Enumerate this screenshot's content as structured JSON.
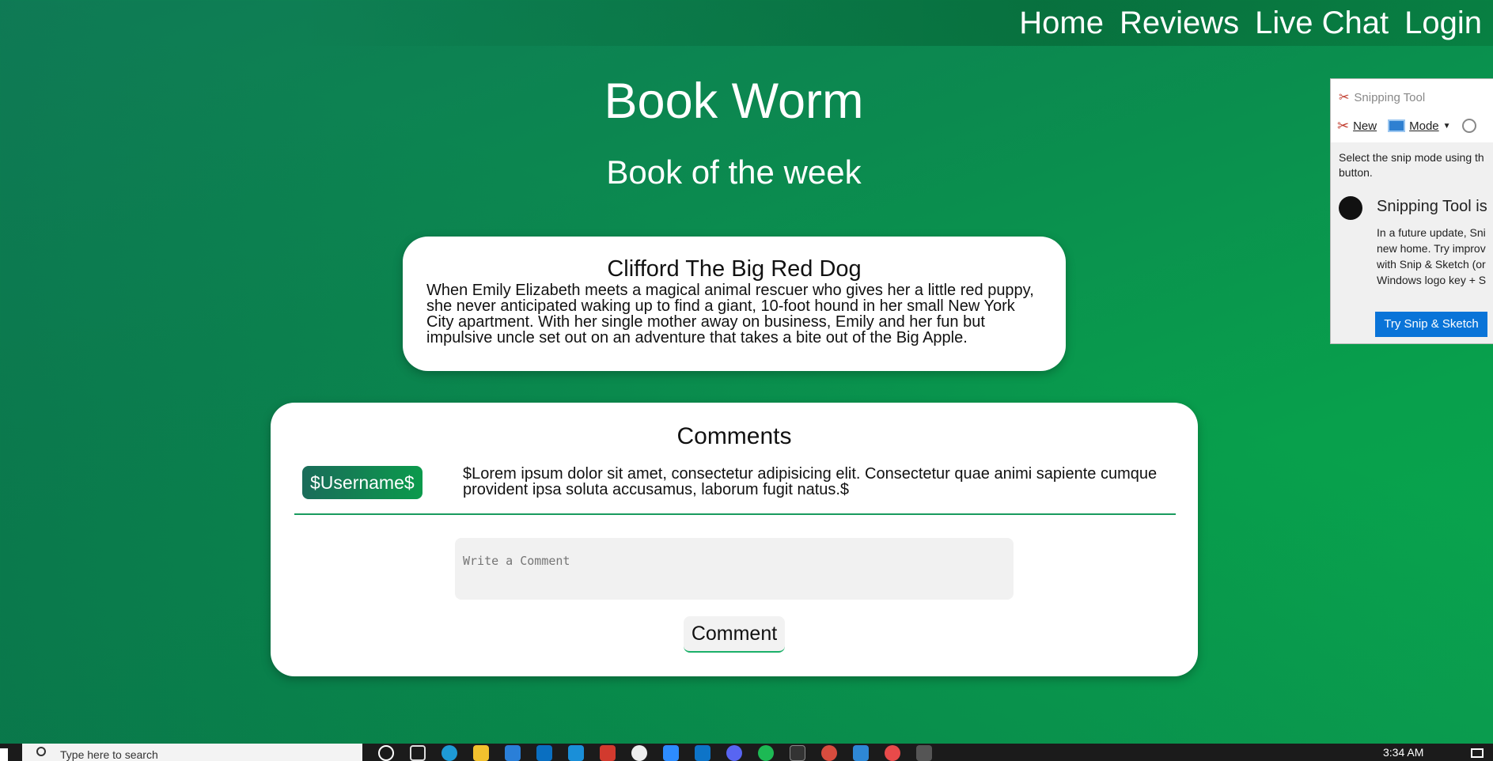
{
  "nav": {
    "items": [
      {
        "label": "Home"
      },
      {
        "label": "Reviews"
      },
      {
        "label": "Live Chat"
      },
      {
        "label": "Login"
      }
    ]
  },
  "site": {
    "title": "Book Worm",
    "subtitle": "Book of the week"
  },
  "book": {
    "title": "Clifford The Big Red Dog",
    "description": "When Emily Elizabeth meets a magical animal rescuer who gives her a little red puppy, she never anticipated waking up to find a giant, 10-foot hound in her small New York City apartment. With her single mother away on business, Emily and her fun but impulsive uncle set out on an adventure that takes a bite out of the Big Apple."
  },
  "comments": {
    "heading": "Comments",
    "items": [
      {
        "username": "$Username$",
        "text": "$Lorem ipsum dolor sit amet, consectetur adipisicing elit. Consectetur quae animi sapiente cumque provident ipsa soluta accusamus, laborum fugit natus.$"
      }
    ],
    "input_placeholder": "Write a Comment",
    "submit_label": "Comment"
  },
  "snipping_tool": {
    "window_title": "Snipping Tool",
    "new_label": "New",
    "mode_label": "Mode",
    "hint": "Select the snip mode using th",
    "hint_line2": "button.",
    "notice_title": "Snipping Tool is",
    "notice_lines": [
      "In a future update, Sni",
      "new home. Try improv",
      "with Snip & Sketch (or",
      "Windows logo key + S"
    ],
    "try_button": "Try Snip & Sketch"
  },
  "taskbar": {
    "search_placeholder": "Type here to search",
    "clock": "3:34 AM"
  },
  "colors": {
    "accent": "#0b9a4c",
    "snip_button": "#0a74d8"
  }
}
